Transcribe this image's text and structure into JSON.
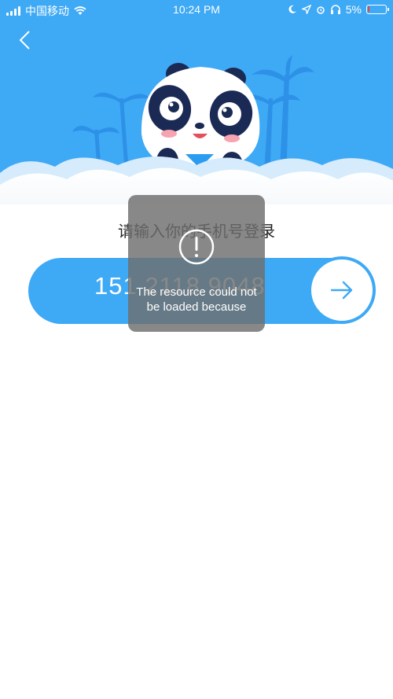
{
  "status_bar": {
    "carrier": "中国移动",
    "time": "10:24 PM",
    "battery": "5%",
    "battery_level": 0.05
  },
  "icons": {
    "back": "chevron-left-icon",
    "next": "arrow-right-icon",
    "alert": "exclamation-circle-icon"
  },
  "login": {
    "title": "请输入你的手机号登录",
    "phone_value": "151 2118 9048"
  },
  "toast": {
    "message": "The resource could not be loaded because"
  },
  "colors": {
    "brand_blue": "#3ea9f5",
    "toast_bg": "#6e6e6e",
    "title_text": "#222222"
  }
}
